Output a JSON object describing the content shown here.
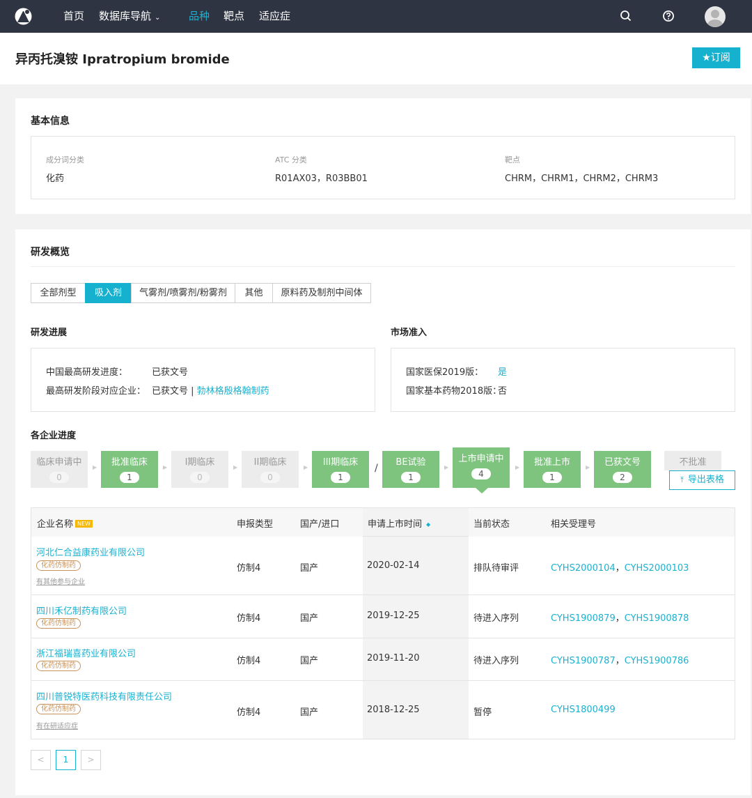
{
  "nav": {
    "items": [
      "首页",
      "数据库导航",
      "品种",
      "靶点",
      "适应症"
    ],
    "active_index": 2,
    "icons": [
      "logo-icon",
      "search-icon",
      "help-icon",
      "user-avatar-icon"
    ],
    "bg_color": "#2f3442",
    "accent_color": "#1ab2d0"
  },
  "header": {
    "title": "异丙托溴铵 Ipratropium bromide",
    "subscribe_label": "★订阅"
  },
  "basic_info": {
    "title": "基本信息",
    "fields": [
      {
        "label": "成分词分类",
        "value": "化药"
      },
      {
        "label": "ATC 分类",
        "value": "R01AX03，R03BB01"
      },
      {
        "label": "靶点",
        "value": "CHRM，CHRM1，CHRM2，CHRM3"
      }
    ]
  },
  "rd_overview": {
    "title": "研发概览",
    "tabs": [
      "全部剂型",
      "吸入剂",
      "气雾剂/喷雾剂/粉雾剂",
      "其他",
      "原料药及制剂中间体"
    ],
    "active_tab": 1,
    "progress": {
      "title": "研发进展",
      "rows": [
        {
          "label": "中国最高研发进度：",
          "value": "已获文号",
          "link": ""
        },
        {
          "label": "最高研发阶段对应企业：",
          "value": "已获文号 |",
          "link": "勃林格殷格翰制药"
        }
      ]
    },
    "market": {
      "title": "市场准入",
      "rows": [
        {
          "label": "国家医保2019版：",
          "value": "是"
        },
        {
          "label": "国家基本药物2018版：",
          "value": "否"
        }
      ]
    },
    "stages_title": "各企业进度",
    "stages": [
      {
        "label": "临床申请中",
        "count": "0",
        "active": false
      },
      {
        "label": "批准临床",
        "count": "1",
        "active": true
      },
      {
        "label": "I期临床",
        "count": "0",
        "active": false
      },
      {
        "label": "II期临床",
        "count": "0",
        "active": false
      },
      {
        "label": "III期临床",
        "count": "1",
        "active": true
      },
      {
        "label": "BE试验",
        "count": "1",
        "active": true
      },
      {
        "label": "上市申请中",
        "count": "4",
        "active": true
      },
      {
        "label": "批准上市",
        "count": "1",
        "active": true
      },
      {
        "label": "已获文号",
        "count": "2",
        "active": true
      },
      {
        "label": "不批准",
        "count": "",
        "active": false
      }
    ],
    "slash": "/",
    "export_label": "导出表格"
  },
  "table": {
    "columns": [
      "企业名称",
      "申报类型",
      "国产/进口",
      "申请上市时间",
      "当前状态",
      "相关受理号"
    ],
    "new_badge": "NEW",
    "rows": [
      {
        "company": "河北仁合益康药业有限公司",
        "tag": "化药仿制药",
        "note": "有其他参与企业",
        "type": "仿制4",
        "origin": "国产",
        "date": "2020-02-14",
        "status": "排队待审评",
        "numbers": [
          "CYHS2000104",
          "CYHS2000103"
        ]
      },
      {
        "company": "四川禾亿制药有限公司",
        "tag": "化药仿制药",
        "note": "",
        "type": "仿制4",
        "origin": "国产",
        "date": "2019-12-25",
        "status": "待进入序列",
        "numbers": [
          "CYHS1900879",
          "CYHS1900878"
        ]
      },
      {
        "company": "浙江福瑞喜药业有限公司",
        "tag": "化药仿制药",
        "note": "",
        "type": "仿制4",
        "origin": "国产",
        "date": "2019-11-20",
        "status": "待进入序列",
        "numbers": [
          "CYHS1900787",
          "CYHS1900786"
        ]
      },
      {
        "company": "四川普锐特医药科技有限责任公司",
        "tag": "化药仿制药",
        "note": "有在研适应症",
        "type": "仿制4",
        "origin": "国产",
        "date": "2018-12-25",
        "status": "暂停",
        "numbers": [
          "CYHS1800499"
        ]
      }
    ]
  },
  "pagination": {
    "prev": "<",
    "current": "1",
    "next": ">"
  }
}
